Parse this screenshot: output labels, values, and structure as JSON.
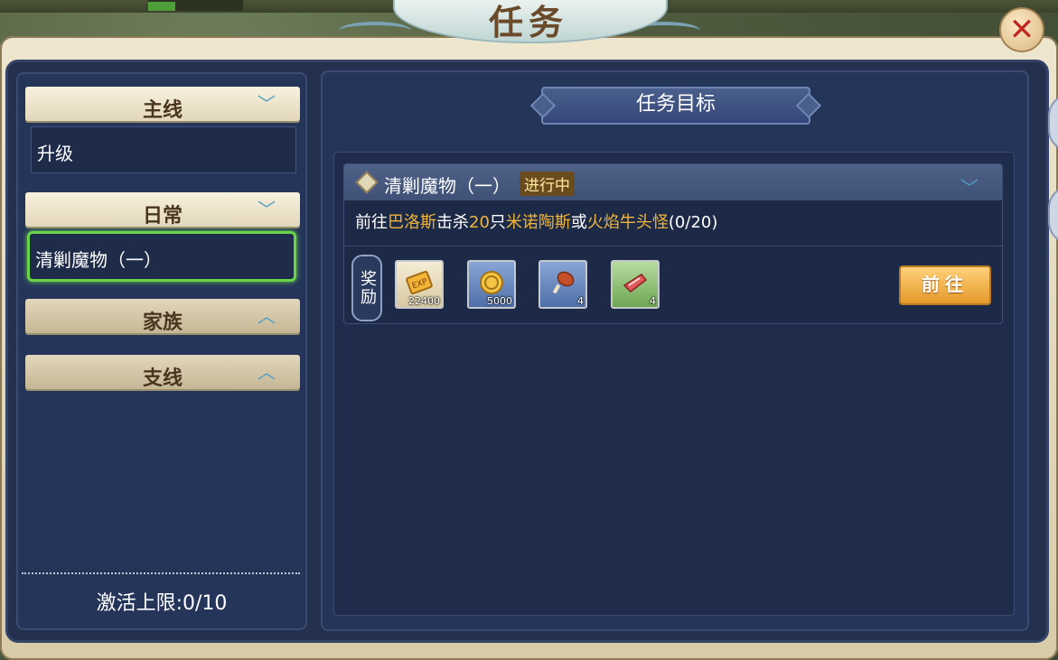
{
  "window": {
    "title": "任务",
    "close_icon": "close-x-icon"
  },
  "sidebar": {
    "categories": [
      {
        "label": "主线",
        "state": "expanded",
        "items": [
          "升级"
        ]
      },
      {
        "label": "日常",
        "state": "expanded",
        "items": [
          "清剿魔物（一）"
        ]
      },
      {
        "label": "家族",
        "state": "collapsed",
        "items": []
      },
      {
        "label": "支线",
        "state": "collapsed",
        "items": []
      }
    ],
    "active_item": "清剿魔物（一）",
    "activation_limit": "激活上限:0/10"
  },
  "main": {
    "header": "任务目标",
    "quest": {
      "name": "清剿魔物（一）",
      "status": "进行中",
      "desc_parts": [
        "前往",
        "巴洛斯",
        "击杀",
        "20",
        "只",
        "米诺陶斯",
        "或",
        "火焰牛头怪",
        "(0/20)"
      ],
      "reward_label": "奖励",
      "rewards": [
        {
          "icon": "exp-icon",
          "qty": "22400"
        },
        {
          "icon": "gold-coin-icon",
          "qty": "5000"
        },
        {
          "icon": "meat-drumstick-icon",
          "qty": "4"
        },
        {
          "icon": "raw-meat-icon",
          "qty": "4"
        }
      ],
      "go_button": "前往"
    }
  },
  "colors": {
    "highlight_text": "#f0b43a",
    "active_border": "#6bd34a",
    "go_button": "#e59a2a"
  }
}
